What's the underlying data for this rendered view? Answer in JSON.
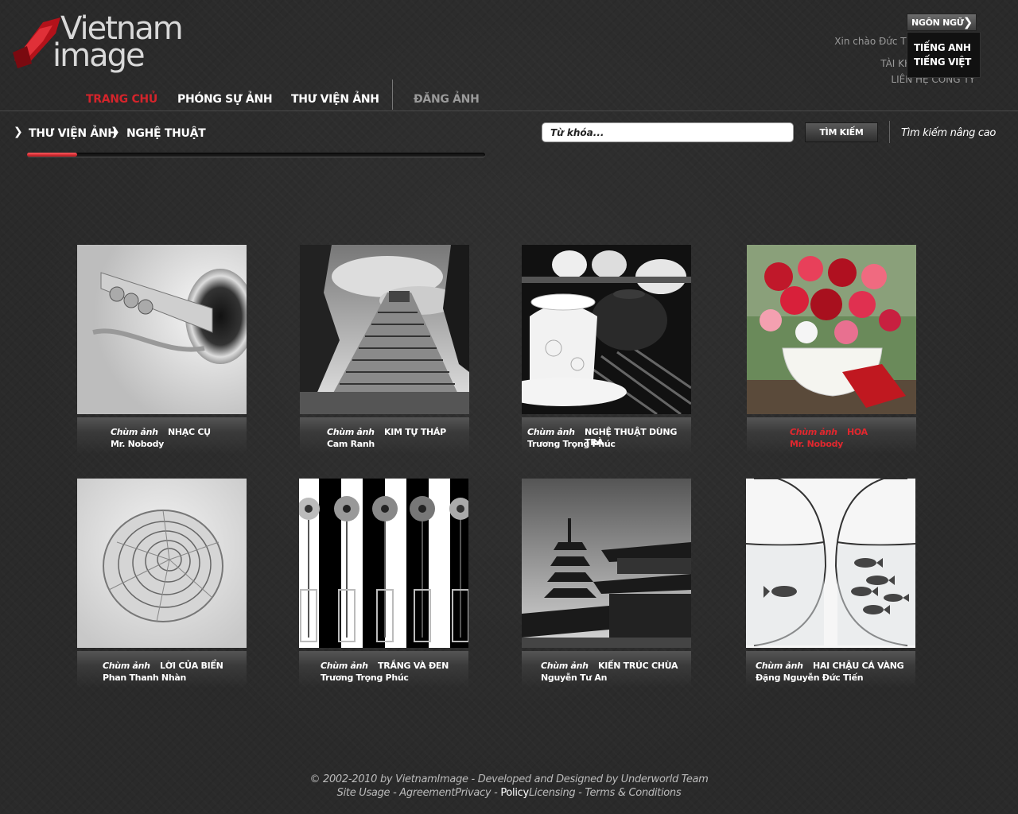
{
  "logo": {
    "line1": "Vietnam",
    "line2": "image"
  },
  "language": {
    "button_label": "NGÔN NGỮ",
    "options": [
      "TIẾNG ANH",
      "TIẾNG VIỆT"
    ]
  },
  "user": {
    "greeting": "Xin chào Đức Tiến, đăng xuất",
    "account": "TÀI KHOẢN CỦA TÔI",
    "contact": "LIÊN HỆ CÔNG TY"
  },
  "nav": {
    "items": [
      "TRANG CHỦ",
      "PHÓNG SỰ ẢNH",
      "THƯ VIỆN ẢNH",
      "ĐĂNG ẢNH"
    ]
  },
  "breadcrumb": [
    "THƯ VIỆN ẢNH",
    "NGHỆ THUẬT"
  ],
  "progress": 0.11,
  "search": {
    "placeholder": "Từ khóa...",
    "button": "TÌM KIẾM",
    "advanced": "Tìm kiếm nâng cao"
  },
  "gallery": {
    "cards": [
      {
        "tag": "Chùm ảnh",
        "title": "NHẠC CỤ",
        "author": "Mr. Nobody"
      },
      {
        "tag": "Chùm ảnh",
        "title": "KIM TỰ THÁP",
        "author": "Cam Ranh"
      },
      {
        "tag": "Chùm ảnh",
        "title": "NGHỆ THUẬT DÙNG TRÀ",
        "author": "Trương Trọng Phúc"
      },
      {
        "tag": "Chùm ảnh",
        "title": "HOA",
        "author": "Mr. Nobody"
      },
      {
        "tag": "Chùm ảnh",
        "title": "LỜI CỦA BIỂN",
        "author": "Phan Thanh Nhàn"
      },
      {
        "tag": "Chùm ảnh",
        "title": "TRẮNG VÀ ĐEN",
        "author": "Trương Trọng Phúc"
      },
      {
        "tag": "Chùm ảnh",
        "title": "KIẾN TRÚC CHÙA",
        "author": "Nguyễn Tư An"
      },
      {
        "tag": "Chùm ảnh",
        "title": "HAI CHẬU CÁ VÀNG",
        "author": "Đặng Nguyễn Đức Tiến"
      }
    ]
  },
  "footer": {
    "line1": "© 2002-2010 by VietnamImage - Developed and Designed by Underworld Team",
    "line2_a": "Site Usage - AgreementPrivacy  - ",
    "line2_b": "Policy",
    "line2_c": "Licensing - Terms & Conditions"
  },
  "colors": {
    "accent": "#d4242b",
    "background": "#2a2a2a"
  }
}
